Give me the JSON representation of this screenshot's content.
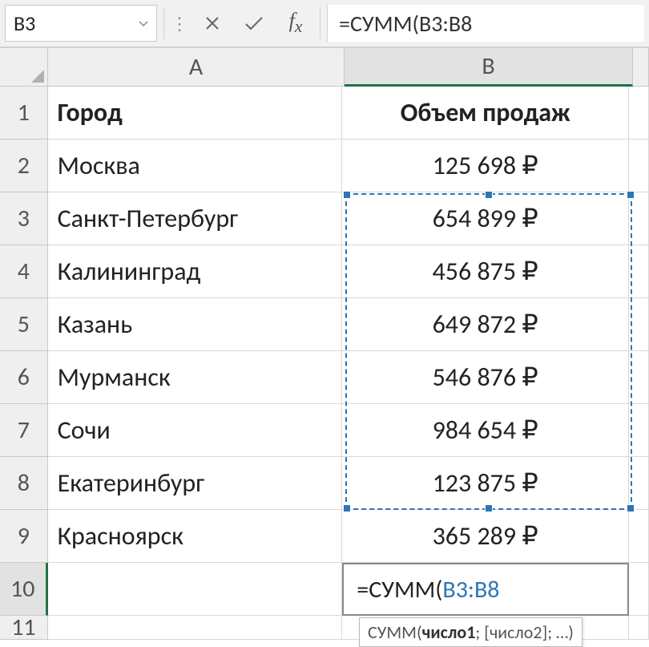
{
  "formula_bar": {
    "name_box": "B3",
    "formula": "=СУММ(B3:B8"
  },
  "columns": [
    "A",
    "B"
  ],
  "headers": {
    "A": "Город",
    "B": "Объем продаж"
  },
  "rows": [
    {
      "n": 1,
      "A": "Город",
      "B": "Объем продаж",
      "header": true
    },
    {
      "n": 2,
      "A": "Москва",
      "B": "125 698 ₽"
    },
    {
      "n": 3,
      "A": "Санкт-Петербург",
      "B": "654 899 ₽"
    },
    {
      "n": 4,
      "A": "Калининград",
      "B": "456 875 ₽"
    },
    {
      "n": 5,
      "A": "Казань",
      "B": "649 872 ₽"
    },
    {
      "n": 6,
      "A": "Мурманск",
      "B": "546 876 ₽"
    },
    {
      "n": 7,
      "A": "Сочи",
      "B": "984 654 ₽"
    },
    {
      "n": 8,
      "A": "Екатеринбург",
      "B": "123 875 ₽"
    },
    {
      "n": 9,
      "A": "Красноярск",
      "B": "365 289 ₽"
    }
  ],
  "active_cell": {
    "row": 10,
    "formula_prefix": "=СУММ(",
    "formula_range": "B3:B8"
  },
  "selection": {
    "col": "B",
    "from_row": 3,
    "to_row": 8
  },
  "tooltip": {
    "func": "СУММ",
    "args": "(число1; [число2]; …)",
    "bold_arg": "число1"
  }
}
